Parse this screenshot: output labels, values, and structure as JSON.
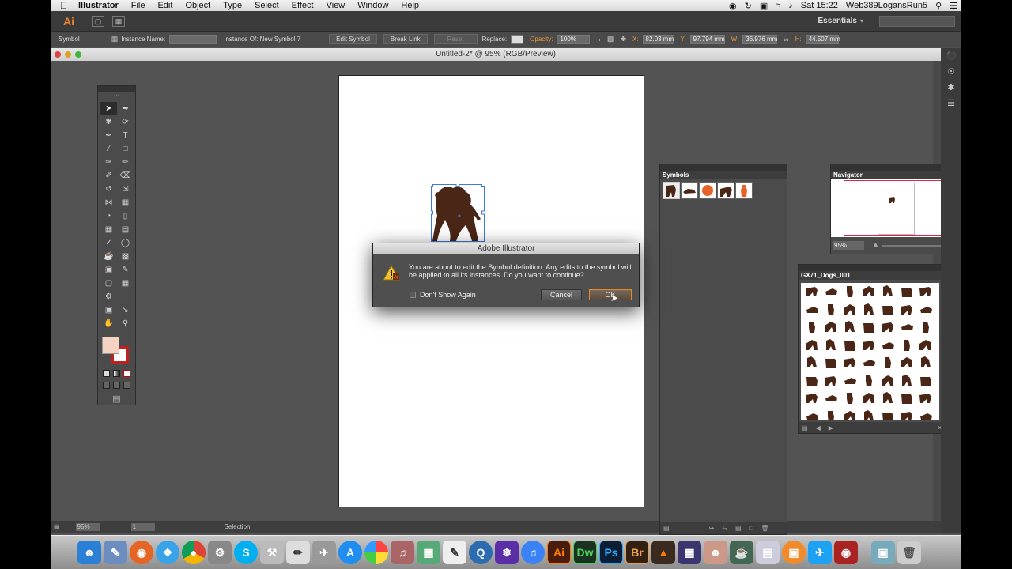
{
  "menubar": {
    "apple": "",
    "app_name": "Illustrator",
    "items": [
      "File",
      "Edit",
      "Object",
      "Type",
      "Select",
      "Effect",
      "View",
      "Window",
      "Help"
    ],
    "clock": "Sat 15:22",
    "user": "Web389LogansRun5"
  },
  "appbar": {
    "logo": "Ai",
    "workspace": "Essentials",
    "search_placeholder": ""
  },
  "control_bar": {
    "selection_type": "Symbol",
    "instance_name_label": "Instance Name:",
    "instance_name_value": "",
    "instance_of_label": "Instance Of: New Symbol 7",
    "edit_symbol": "Edit Symbol",
    "break_link": "Break Link",
    "reset": "Reset",
    "replace_label": "Replace:",
    "opacity_label": "Opacity:",
    "opacity_value": "100%",
    "x_label": "X:",
    "x_value": "82.03 mm",
    "y_label": "Y:",
    "y_value": "97.794 mm",
    "w_label": "W:",
    "w_value": "36.976 mm",
    "h_label": "H:",
    "h_value": "44.507 mm"
  },
  "document": {
    "title": "Untitled-2* @ 95% (RGB/Preview)",
    "zoom": "95%",
    "page": "1",
    "status": "Selection"
  },
  "panels": {
    "symbols_title": "Symbols",
    "navigator_title": "Navigator",
    "navigator_zoom": "95%",
    "library_title": "GX71_Dogs_001"
  },
  "dialog": {
    "title": "Adobe Illustrator",
    "message": "You are about to edit the Symbol definition. Any edits to the symbol will be applied to all its instances. Do you want to continue?",
    "checkbox_label": "Don't Show Again",
    "checkbox_checked": false,
    "cancel": "Cancel",
    "ok": "OK"
  },
  "dock": {
    "apps": [
      "Finder",
      "Preview",
      "Firefox",
      "Safari",
      "Chrome",
      "System Preferences",
      "Skype",
      "Utility",
      "Pencils",
      "Rocket",
      "App Store",
      "Photos",
      "Music",
      "Photo Booth",
      "TextEdit",
      "QuickTime",
      "Snowflake",
      "iTunes",
      "Ai",
      "Dw",
      "Ps",
      "Br",
      "Acrobat",
      "Bridge",
      "Face",
      "Cup",
      "Preview 2",
      "Books",
      "Twitter",
      "Photo Booth 2",
      "Downloads",
      "Trash"
    ]
  },
  "colors": {
    "accent_orange": "#e8832a",
    "fill": "#f5d3c3",
    "stroke": "#b22222",
    "navigator_frame": "#d8244c",
    "dog": "#4a2616"
  }
}
